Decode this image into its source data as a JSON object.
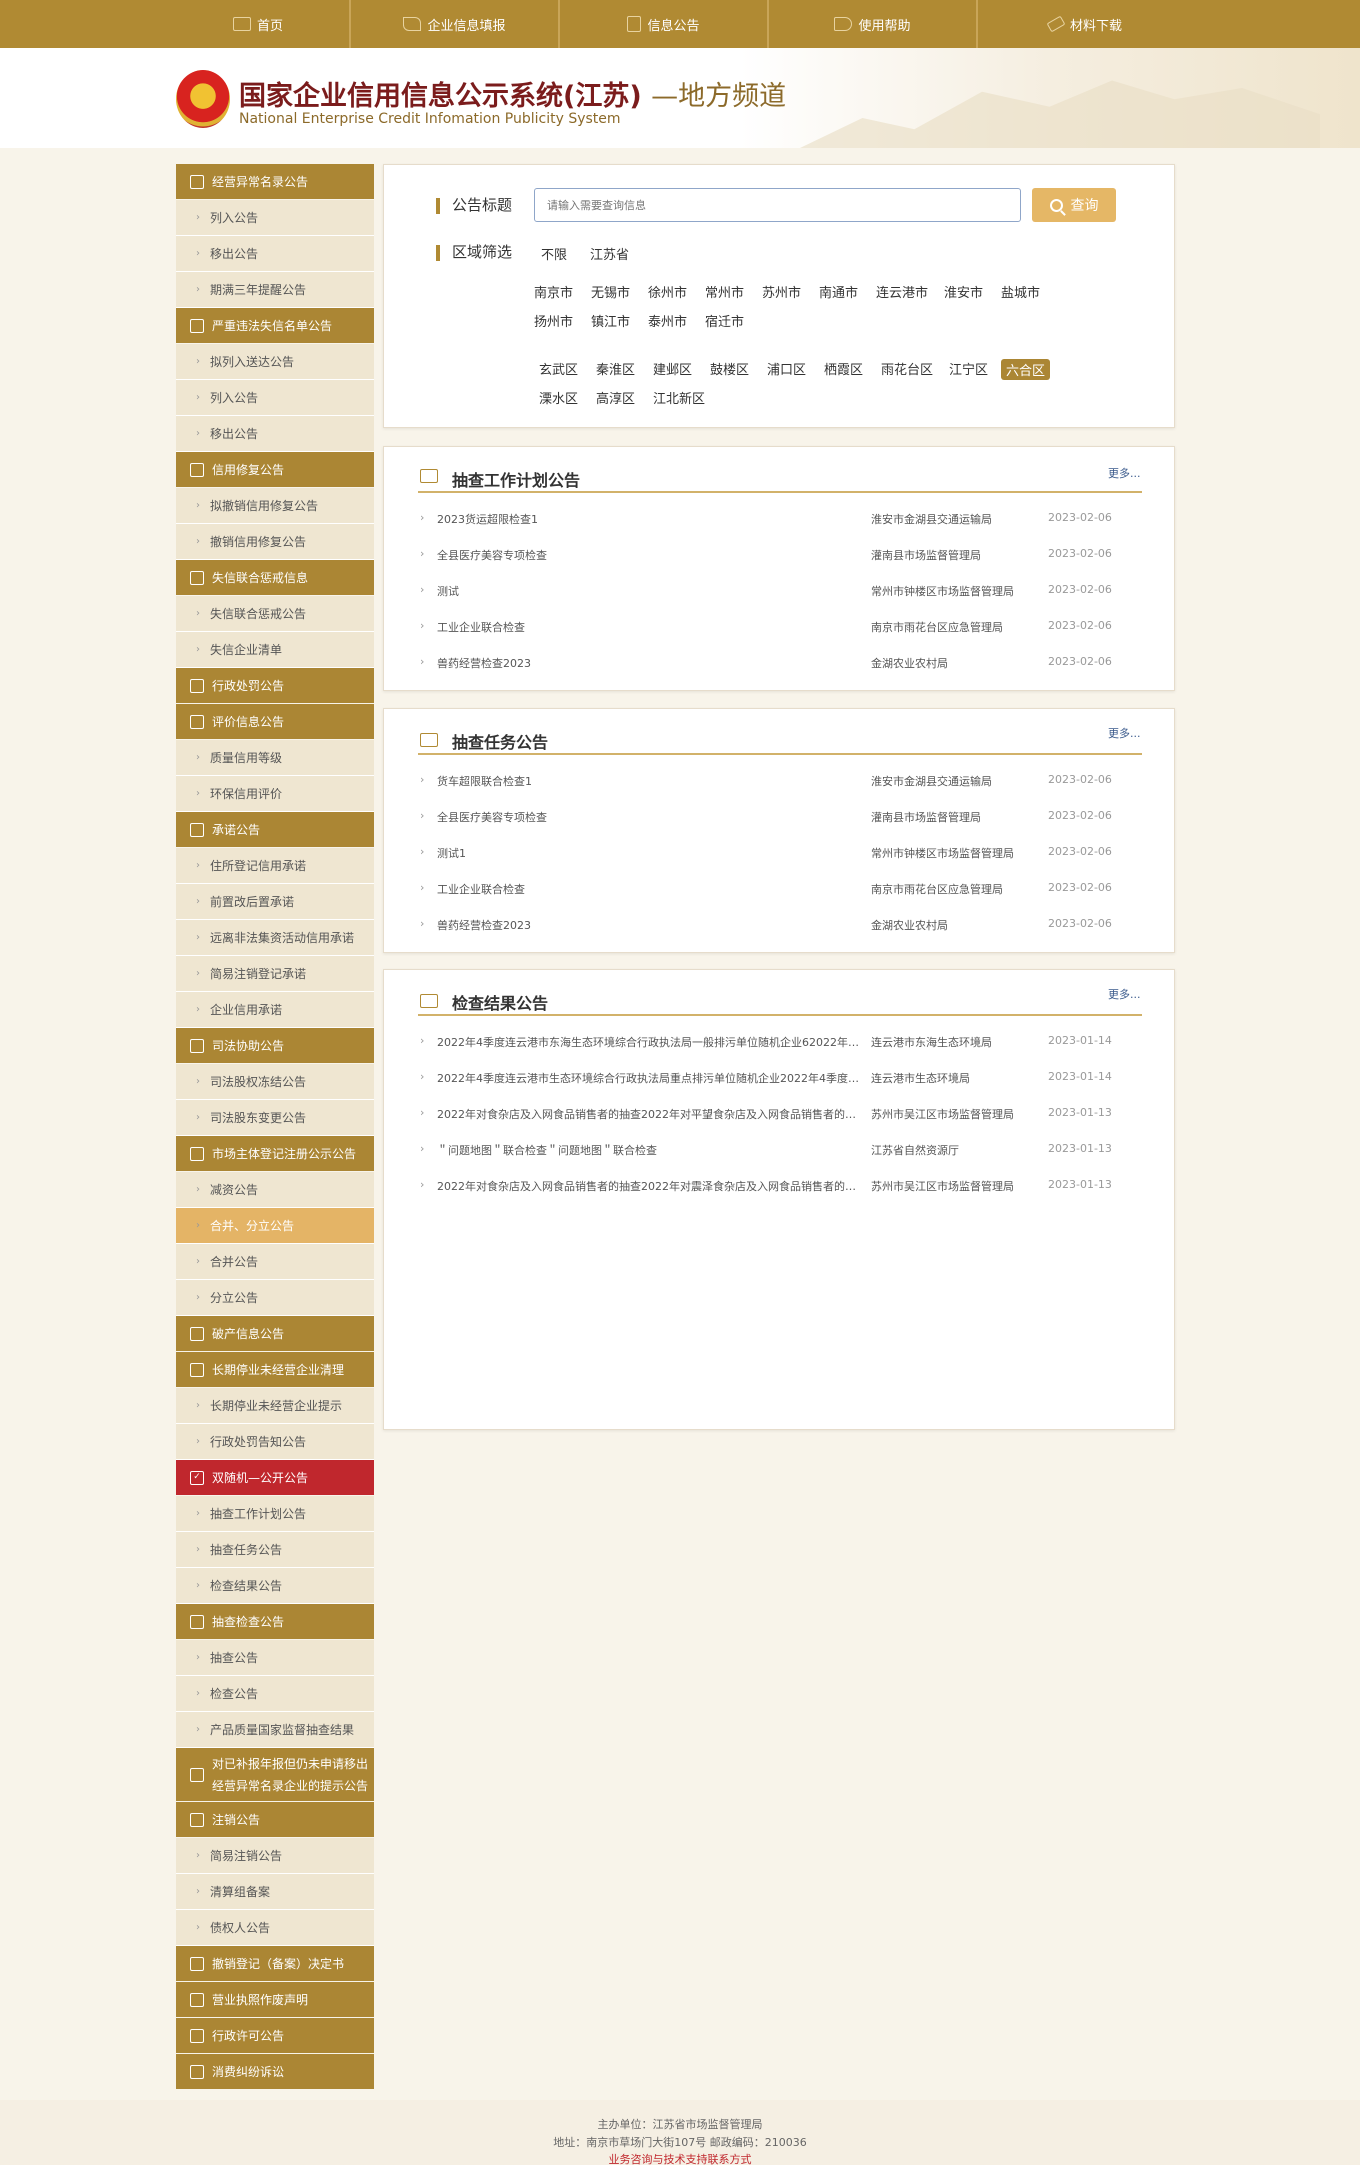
{
  "nav": {
    "items": [
      {
        "label": "首页",
        "icon": "monitor-icon"
      },
      {
        "label": "企业信息填报",
        "icon": "edit-icon"
      },
      {
        "label": "信息公告",
        "icon": "document-icon"
      },
      {
        "label": "使用帮助",
        "icon": "speaker-icon"
      },
      {
        "label": "材料下载",
        "icon": "pen-icon"
      }
    ]
  },
  "header": {
    "title": "国家企业信用信息公示系统(江苏)",
    "title_suffix": "—地方频道",
    "subtitle": "National Enterprise Credit Infomation Publicity System"
  },
  "sidebar": {
    "items": [
      {
        "label": "经营异常名录公告",
        "type": "cat"
      },
      {
        "label": "列入公告",
        "type": "item"
      },
      {
        "label": "移出公告",
        "type": "item"
      },
      {
        "label": "期满三年提醒公告",
        "type": "item"
      },
      {
        "label": "严重违法失信名单公告",
        "type": "cat"
      },
      {
        "label": "拟列入送达公告",
        "type": "item"
      },
      {
        "label": "列入公告",
        "type": "item"
      },
      {
        "label": "移出公告",
        "type": "item"
      },
      {
        "label": "信用修复公告",
        "type": "cat"
      },
      {
        "label": "拟撤销信用修复公告",
        "type": "item"
      },
      {
        "label": "撤销信用修复公告",
        "type": "item"
      },
      {
        "label": "失信联合惩戒信息",
        "type": "cat"
      },
      {
        "label": "失信联合惩戒公告",
        "type": "item"
      },
      {
        "label": "失信企业清单",
        "type": "item"
      },
      {
        "label": "行政处罚公告",
        "type": "cat"
      },
      {
        "label": "评价信息公告",
        "type": "cat"
      },
      {
        "label": "质量信用等级",
        "type": "item"
      },
      {
        "label": "环保信用评价",
        "type": "item"
      },
      {
        "label": "承诺公告",
        "type": "cat"
      },
      {
        "label": "住所登记信用承诺",
        "type": "item"
      },
      {
        "label": "前置改后置承诺",
        "type": "item"
      },
      {
        "label": "远离非法集资活动信用承诺",
        "type": "item"
      },
      {
        "label": "简易注销登记承诺",
        "type": "item"
      },
      {
        "label": "企业信用承诺",
        "type": "item"
      },
      {
        "label": "司法协助公告",
        "type": "cat"
      },
      {
        "label": "司法股权冻结公告",
        "type": "item"
      },
      {
        "label": "司法股东变更公告",
        "type": "item"
      },
      {
        "label": "市场主体登记注册公示公告",
        "type": "cat"
      },
      {
        "label": "减资公告",
        "type": "item"
      },
      {
        "label": "合并、分立公告",
        "type": "item",
        "active": true
      },
      {
        "label": "合并公告",
        "type": "item"
      },
      {
        "label": "分立公告",
        "type": "item"
      },
      {
        "label": "破产信息公告",
        "type": "cat"
      },
      {
        "label": "长期停业未经营企业清理",
        "type": "cat"
      },
      {
        "label": "长期停业未经营企业提示",
        "type": "item"
      },
      {
        "label": "行政处罚告知公告",
        "type": "item"
      },
      {
        "label": "双随机—公开公告",
        "type": "cat",
        "red": true
      },
      {
        "label": "抽查工作计划公告",
        "type": "item"
      },
      {
        "label": "抽查任务公告",
        "type": "item"
      },
      {
        "label": "检查结果公告",
        "type": "item"
      },
      {
        "label": "抽查检查公告",
        "type": "cat"
      },
      {
        "label": "抽查公告",
        "type": "item"
      },
      {
        "label": "检查公告",
        "type": "item"
      },
      {
        "label": "产品质量国家监督抽查结果",
        "type": "item"
      },
      {
        "label": "对已补报年报但仍未申请移出经营异常名录企业的提示公告",
        "type": "cat",
        "two": true
      },
      {
        "label": "注销公告",
        "type": "cat"
      },
      {
        "label": "简易注销公告",
        "type": "item"
      },
      {
        "label": "清算组备案",
        "type": "item"
      },
      {
        "label": "债权人公告",
        "type": "item"
      },
      {
        "label": "撤销登记（备案）决定书",
        "type": "cat"
      },
      {
        "label": "营业执照作废声明",
        "type": "cat"
      },
      {
        "label": "行政许可公告",
        "type": "cat"
      },
      {
        "label": "消费纠纷诉讼",
        "type": "cat"
      }
    ]
  },
  "search": {
    "label": "公告标题",
    "placeholder": "请输入需要查询信息",
    "button_label": "查询",
    "region_label": "区域筛选",
    "top_options": [
      "不限",
      "江苏省"
    ],
    "cities": [
      "南京市",
      "无锡市",
      "徐州市",
      "常州市",
      "苏州市",
      "南通市",
      "连云港市",
      "淮安市",
      "盐城市",
      "扬州市",
      "镇江市",
      "泰州市",
      "宿迁市"
    ],
    "districts": [
      "玄武区",
      "秦淮区",
      "建邺区",
      "鼓楼区",
      "浦口区",
      "栖霞区",
      "雨花台区",
      "江宁区",
      "六合区",
      "溧水区",
      "高淳区",
      "江北新区"
    ],
    "selected_district": "六合区"
  },
  "panels": [
    {
      "title": "抽查工作计划公告",
      "more": "更多...",
      "rows": [
        {
          "title": "2023货运超限检查1",
          "org": "淮安市金湖县交通运输局",
          "date": "2023-02-06"
        },
        {
          "title": "全县医疗美容专项检查",
          "org": "灌南县市场监督管理局",
          "date": "2023-02-06"
        },
        {
          "title": "测试",
          "org": "常州市钟楼区市场监督管理局",
          "date": "2023-02-06"
        },
        {
          "title": "工业企业联合检查",
          "org": "南京市雨花台区应急管理局",
          "date": "2023-02-06"
        },
        {
          "title": "兽药经营检查2023",
          "org": "金湖农业农村局",
          "date": "2023-02-06"
        }
      ]
    },
    {
      "title": "抽查任务公告",
      "more": "更多...",
      "rows": [
        {
          "title": "货车超限联合检查1",
          "org": "淮安市金湖县交通运输局",
          "date": "2023-02-06"
        },
        {
          "title": "全县医疗美容专项检查",
          "org": "灌南县市场监督管理局",
          "date": "2023-02-06"
        },
        {
          "title": "测试1",
          "org": "常州市钟楼区市场监督管理局",
          "date": "2023-02-06"
        },
        {
          "title": "工业企业联合检查",
          "org": "南京市雨花台区应急管理局",
          "date": "2023-02-06"
        },
        {
          "title": "兽药经营检查2023",
          "org": "金湖农业农村局",
          "date": "2023-02-06"
        }
      ]
    },
    {
      "title": "检查结果公告",
      "more": "更多...",
      "rows": [
        {
          "title": "2022年4季度连云港市东海生态环境综合行政执法局一般排污单位随机企业62022年4...",
          "org": "连云港市东海生态环境局",
          "date": "2023-01-14"
        },
        {
          "title": "2022年4季度连云港市生态环境综合行政执法局重点排污单位随机企业2022年4季度连...",
          "org": "连云港市生态环境局",
          "date": "2023-01-14"
        },
        {
          "title": "2022年对食杂店及入网食品销售者的抽查2022年对平望食杂店及入网食品销售者的抽查",
          "org": "苏州市吴江区市场监督管理局",
          "date": "2023-01-13"
        },
        {
          "title": "＂问题地图＂联合检查＂问题地图＂联合检查",
          "org": "江苏省自然资源厅",
          "date": "2023-01-13"
        },
        {
          "title": "2022年对食杂店及入网食品销售者的抽查2022年对震泽食杂店及入网食品销售者的抽查",
          "org": "苏州市吴江区市场监督管理局",
          "date": "2023-01-13"
        }
      ]
    }
  ],
  "footer": {
    "host": "主办单位：江苏省市场监督管理局",
    "address": "地址：南京市草场门大街107号    邮政编码：210036",
    "contact": "业务咨询与技术支持联系方式",
    "contact_color": "#c0272d"
  }
}
